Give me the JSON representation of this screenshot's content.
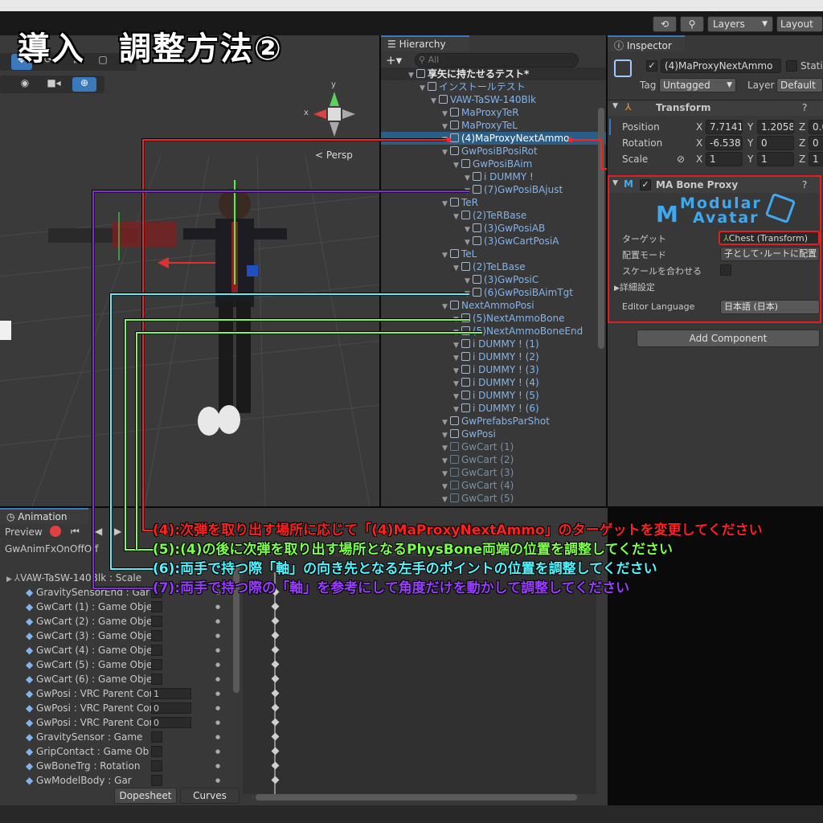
{
  "title": "導入　調整方法②",
  "toolbar": {
    "layers": "Layers",
    "layout": "Layout"
  },
  "scene": {
    "persp": "< Persp",
    "axis_x": "x",
    "axis_y": "y"
  },
  "hierarchy": {
    "tab": "Hierarchy",
    "search_placeholder": "All",
    "items": [
      {
        "label": "享矢に持たせるテスト*",
        "indent": 0,
        "style": "root"
      },
      {
        "label": "インストールテスト",
        "indent": 1,
        "style": "blue"
      },
      {
        "label": "VAW-TaSW-140Blk",
        "indent": 2,
        "style": "blue"
      },
      {
        "label": "MaProxyTeR",
        "indent": 3,
        "style": "blue"
      },
      {
        "label": "MaProxyTeL",
        "indent": 3,
        "style": "blue"
      },
      {
        "label": "(4)MaProxyNextAmmo",
        "indent": 3,
        "style": "sel"
      },
      {
        "label": "GwPosiBPosiRot",
        "indent": 3,
        "style": "blue"
      },
      {
        "label": "GwPosiBAim",
        "indent": 4,
        "style": "blue"
      },
      {
        "label": "i DUMMY !",
        "indent": 5,
        "style": "blue"
      },
      {
        "label": "(7)GwPosiBAjust",
        "indent": 5,
        "style": "blue"
      },
      {
        "label": "TeR",
        "indent": 3,
        "style": "blue"
      },
      {
        "label": "(2)TeRBase",
        "indent": 4,
        "style": "blue"
      },
      {
        "label": "(3)GwPosiAB",
        "indent": 5,
        "style": "blue"
      },
      {
        "label": "(3)GwCartPosiA",
        "indent": 5,
        "style": "blue"
      },
      {
        "label": "TeL",
        "indent": 3,
        "style": "blue"
      },
      {
        "label": "(2)TeLBase",
        "indent": 4,
        "style": "blue"
      },
      {
        "label": "(3)GwPosiC",
        "indent": 5,
        "style": "blue"
      },
      {
        "label": "(6)GwPosiBAimTgt",
        "indent": 5,
        "style": "blue"
      },
      {
        "label": "NextAmmoPosi",
        "indent": 3,
        "style": "blue"
      },
      {
        "label": "(5)NextAmmoBone",
        "indent": 4,
        "style": "blue"
      },
      {
        "label": "(5)NextAmmoBoneEnd",
        "indent": 4,
        "style": "blue"
      },
      {
        "label": "i DUMMY ! (1)",
        "indent": 4,
        "style": "blue"
      },
      {
        "label": "i DUMMY ! (2)",
        "indent": 4,
        "style": "blue"
      },
      {
        "label": "i DUMMY ! (3)",
        "indent": 4,
        "style": "blue"
      },
      {
        "label": "i DUMMY ! (4)",
        "indent": 4,
        "style": "blue"
      },
      {
        "label": "i DUMMY ! (5)",
        "indent": 4,
        "style": "blue"
      },
      {
        "label": "i DUMMY ! (6)",
        "indent": 4,
        "style": "blue"
      },
      {
        "label": "GwPrefabsParShot",
        "indent": 3,
        "style": "blue"
      },
      {
        "label": "GwPosi",
        "indent": 3,
        "style": "blue"
      },
      {
        "label": "GwCart (1)",
        "indent": 3,
        "style": "grey"
      },
      {
        "label": "GwCart (2)",
        "indent": 3,
        "style": "grey"
      },
      {
        "label": "GwCart (3)",
        "indent": 3,
        "style": "grey"
      },
      {
        "label": "GwCart (4)",
        "indent": 3,
        "style": "grey"
      },
      {
        "label": "GwCart (5)",
        "indent": 3,
        "style": "grey"
      }
    ]
  },
  "inspector": {
    "tab": "Inspector",
    "object_name": "(4)MaProxyNextAmmo",
    "static": "Stati",
    "tag_label": "Tag",
    "tag_value": "Untagged",
    "layer_label": "Layer",
    "layer_value": "Default",
    "transform": {
      "header": "Transform",
      "position_label": "Position",
      "rotation_label": "Rotation",
      "scale_label": "Scale",
      "pos": {
        "x": "7.7141",
        "y": "1.2058",
        "z": "0.0"
      },
      "rot": {
        "x": "-6.538",
        "y": "0",
        "z": "0"
      },
      "scl": {
        "x": "1",
        "y": "1",
        "z": "1"
      }
    },
    "bone_proxy": {
      "header": "MA Bone Proxy",
      "logo_line1": "Modular",
      "logo_line2": "Avatar",
      "target_label": "ターゲット",
      "target_value": "Chest (Transform)",
      "placement_label": "配置モード",
      "placement_value": "子として･ルートに配置",
      "scale_label": "スケールを合わせる",
      "advanced_label": "詳細設定",
      "language_label": "Editor Language",
      "language_value": "日本語 (日本)"
    },
    "add_component": "Add Component"
  },
  "animation": {
    "tab": "Animation",
    "preview": "Preview",
    "clip": "GwAnimFxOnOffOff",
    "root_row": "VAW-TaSW-140Blk : Scale",
    "rows": [
      {
        "label": "GravitySensorEnd : Gar",
        "value": ""
      },
      {
        "label": "GwCart (1) : Game Object",
        "value": ""
      },
      {
        "label": "GwCart (2) : Game Object",
        "value": ""
      },
      {
        "label": "GwCart (3) : Game Object",
        "value": ""
      },
      {
        "label": "GwCart (4) : Game Object",
        "value": ""
      },
      {
        "label": "GwCart (5) : Game Object",
        "value": ""
      },
      {
        "label": "GwCart (6) : Game Object",
        "value": ""
      },
      {
        "label": "GwPosi : VRC Parent Cor",
        "value": "1"
      },
      {
        "label": "GwPosi : VRC Parent Cor",
        "value": "0"
      },
      {
        "label": "GwPosi : VRC Parent Cor",
        "value": "0"
      },
      {
        "label": "GravitySensor : Game",
        "value": ""
      },
      {
        "label": "GripContact : Game Ob",
        "value": ""
      },
      {
        "label": "GwBoneTrg : Rotation",
        "value": ""
      },
      {
        "label": "GwModelBody : Gar",
        "value": ""
      }
    ],
    "dopesheet": "Dopesheet",
    "curves": "Curves"
  },
  "notes": [
    {
      "text": "(4):次弾を取り出す場所に応じて「(4)MaProxyNextAmmo」のターゲットを変更してください",
      "color": "#ff2020"
    },
    {
      "text": "(5):(4)の後に次弾を取り出す場所となるPhysBone両端の位置を調整してください",
      "color": "#7cff4a"
    },
    {
      "text": "(6):両手で持つ際「軸」の向き先となる左手のポイントの位置を調整してください",
      "color": "#4ff5ff"
    },
    {
      "text": "(7):両手で持つ際の「軸」を参考にして角度だけを動かして調整してください",
      "color": "#9a3cff"
    }
  ],
  "colors": {
    "red": "#ff2020",
    "green": "#7cff4a",
    "cyan": "#4ff5ff",
    "purple": "#8a2be2",
    "selection": "#2c5d87",
    "accent": "#3a79bb"
  }
}
